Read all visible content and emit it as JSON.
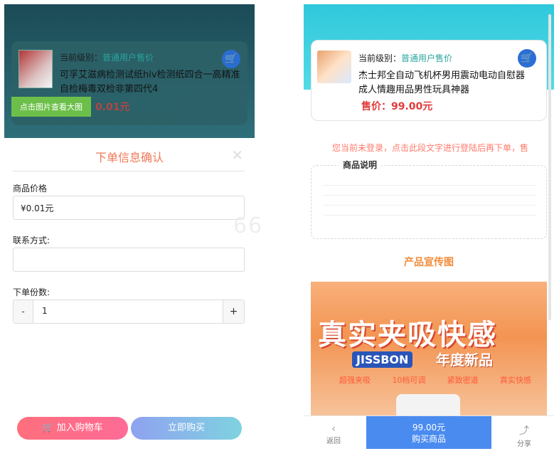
{
  "left": {
    "level_label": "当前级别：",
    "level_value": "普通用户售价",
    "product_title": "可孚艾滋病检测试纸hiv检测纸四合一高精准自检梅毒双检非第四代4",
    "price_partial": "0.01元",
    "view_image_tag": "点击图片查看大图",
    "sheet_title": "下单信息确认",
    "price_label": "商品价格",
    "price_value": "¥0.01元",
    "contact_label": "联系方式:",
    "contact_value": "",
    "qty_label": "下单份数:",
    "qty_value": "1",
    "minus": "-",
    "plus": "+",
    "add_cart": "加入购物车",
    "buy_now": "立即购买",
    "watermark": "66"
  },
  "right": {
    "level_label": "当前级别：",
    "level_value": "普通用户售价",
    "product_title": "杰士邦全自动飞机杯男用震动电动自慰器成人情趣用品男性玩具神器",
    "price": "售价：99.00元",
    "login_tip": "您当前未登录，点击此段文字进行登陆后再下单，售",
    "desc_title": "商品说明",
    "promo_title": "产品宣传图",
    "promo_big": "真实夹吸快感",
    "promo_brand": "JISSBON",
    "promo_new": "年度新品",
    "promo_feats": [
      "超强夹吸",
      "10档可调",
      "紧致密道",
      "真实快感"
    ],
    "back": "返回",
    "bottom_price": "99.00元",
    "bottom_buy": "购买商品",
    "share": "分享"
  }
}
